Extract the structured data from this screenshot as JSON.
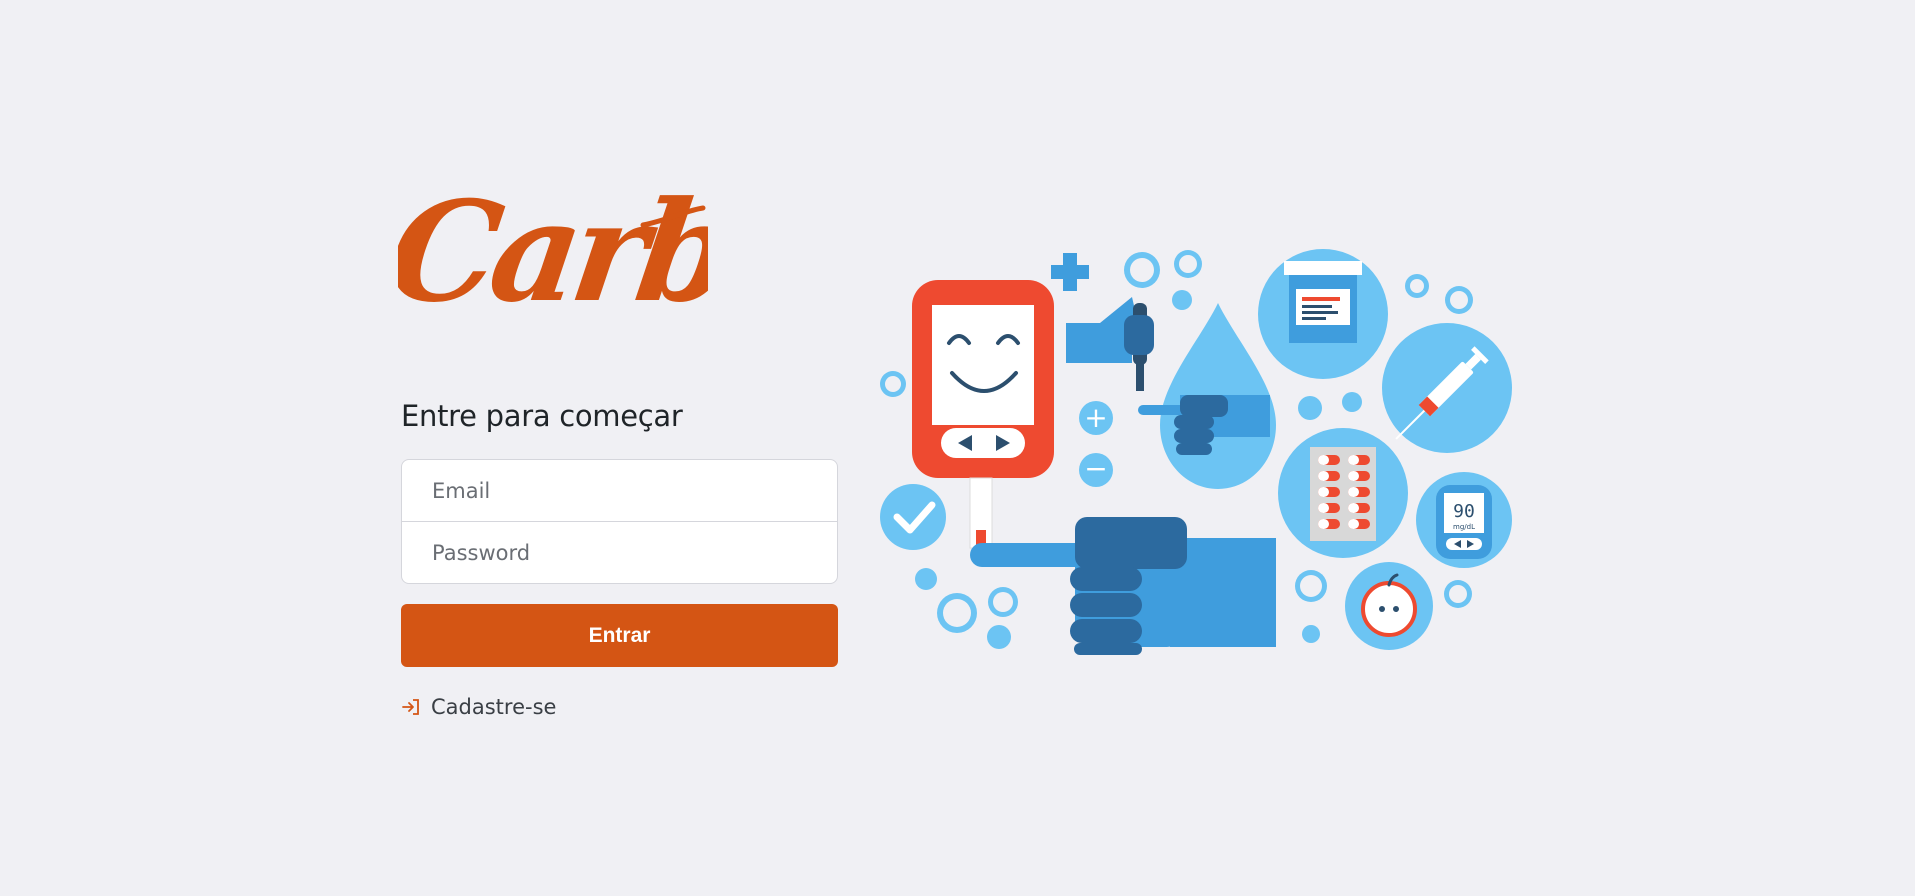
{
  "brand": {
    "name": "Carb",
    "color": "#d45514"
  },
  "login": {
    "heading": "Entre para começar",
    "email_placeholder": "Email",
    "password_placeholder": "Password",
    "submit_label": "Entrar",
    "signup_label": "Cadastre-se",
    "signup_icon": "sign-in-icon"
  },
  "illustration": {
    "meter_reading": "90",
    "meter_unit": "mg/dL"
  },
  "colors": {
    "background": "#f0f0f4",
    "primary": "#d45514",
    "light_blue": "#6cc4f3",
    "mid_blue": "#3f9ddd",
    "dark_blue": "#2c6a9f",
    "red": "#ee4a30"
  }
}
